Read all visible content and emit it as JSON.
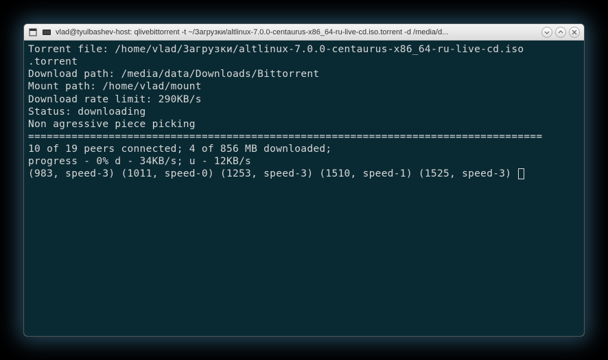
{
  "window": {
    "title": "vlad@tyulbashev-host: qlivebittorrent -t ~/Загрузки/altlinux-7.0.0-centaurus-x86_64-ru-live-cd.iso.torrent -d /media/d..."
  },
  "terminal": {
    "torrent_file_label": "Torrent file: ",
    "torrent_file_value": "/home/vlad/Загрузки/altlinux-7.0.0-centaurus-x86_64-ru-live-cd.iso",
    "torrent_ext": ".torrent",
    "download_path_label": "Download path: ",
    "download_path_value": "/media/data/Downloads/Bittorrent",
    "mount_path_label": "Mount path: ",
    "mount_path_value": "/home/vlad/mount",
    "rate_limit_label": "Download rate limit: ",
    "rate_limit_value": "290KB/s",
    "status_label": "Status: ",
    "status_value": "downloading",
    "piece_picking": "Non agressive piece picking",
    "separator": "===================================================================================",
    "peers_line": "10 of 19 peers connected; 4 of 856 MB downloaded;",
    "progress_line": "progress - 0% d - 34KB/s; u - 12KB/s",
    "speed_line": "(983, speed-3) (1011, speed-0) (1253, speed-3) (1510, speed-1) (1525, speed-3) "
  }
}
